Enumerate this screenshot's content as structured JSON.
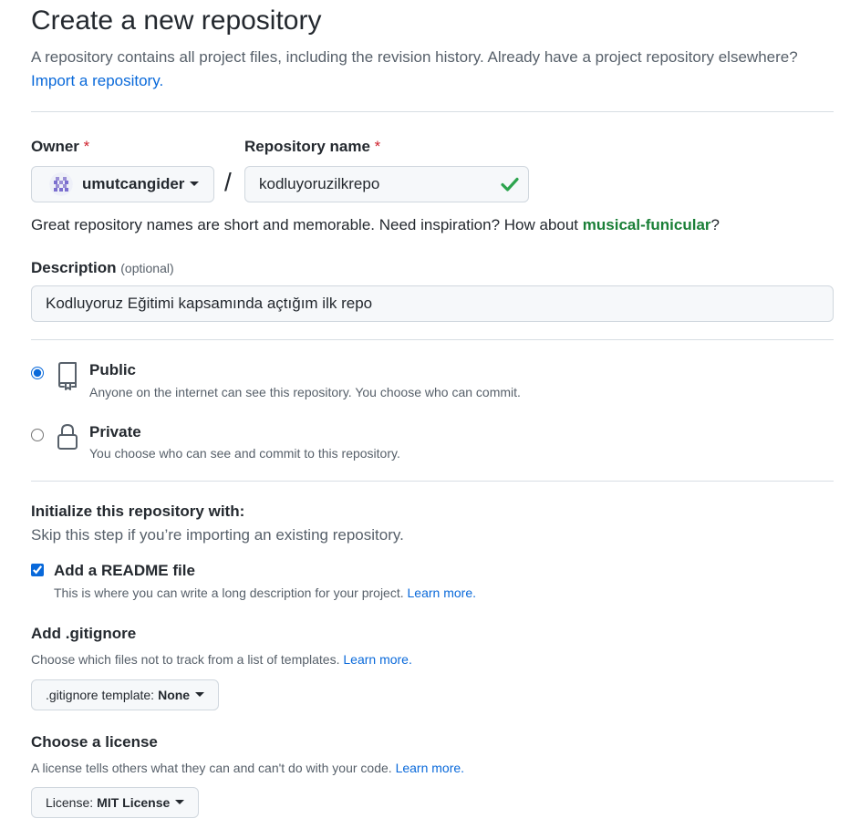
{
  "header": {
    "title": "Create a new repository",
    "subtitle": "A repository contains all project files, including the revision history. Already have a project repository elsewhere?",
    "import_link": "Import a repository."
  },
  "owner": {
    "label": "Owner",
    "required_mark": "*",
    "value": "umutcangider"
  },
  "repo_name": {
    "label": "Repository name",
    "required_mark": "*",
    "value": "kodluyoruzilkrepo",
    "slash": "/"
  },
  "name_hint": {
    "text": "Great repository names are short and memorable. Need inspiration? How about",
    "suggestion": "musical-funicular",
    "end": "?"
  },
  "description": {
    "label": "Description",
    "optional": "(optional)",
    "value": "Kodluyoruz Eğitimi kapsamında açtığım ilk repo"
  },
  "visibility": {
    "public": {
      "title": "Public",
      "desc": "Anyone on the internet can see this repository. You choose who can commit.",
      "selected": true
    },
    "private": {
      "title": "Private",
      "desc": "You choose who can see and commit to this repository.",
      "selected": false
    }
  },
  "initialize": {
    "title": "Initialize this repository with:",
    "subtitle": "Skip this step if you’re importing an existing repository.",
    "readme": {
      "label": "Add a README file",
      "desc": "This is where you can write a long description for your project.",
      "learn_more": "Learn more.",
      "checked": true
    }
  },
  "gitignore": {
    "title": "Add .gitignore",
    "desc": "Choose which files not to track from a list of templates.",
    "learn_more": "Learn more.",
    "button_prefix": ".gitignore template:",
    "button_value": "None"
  },
  "license": {
    "title": "Choose a license",
    "desc": "A license tells others what they can and can't do with your code.",
    "learn_more": "Learn more.",
    "button_prefix": "License:",
    "button_value": "MIT License"
  },
  "colors": {
    "link": "#0969da",
    "success": "#1a7f37",
    "required": "#cf222e"
  }
}
